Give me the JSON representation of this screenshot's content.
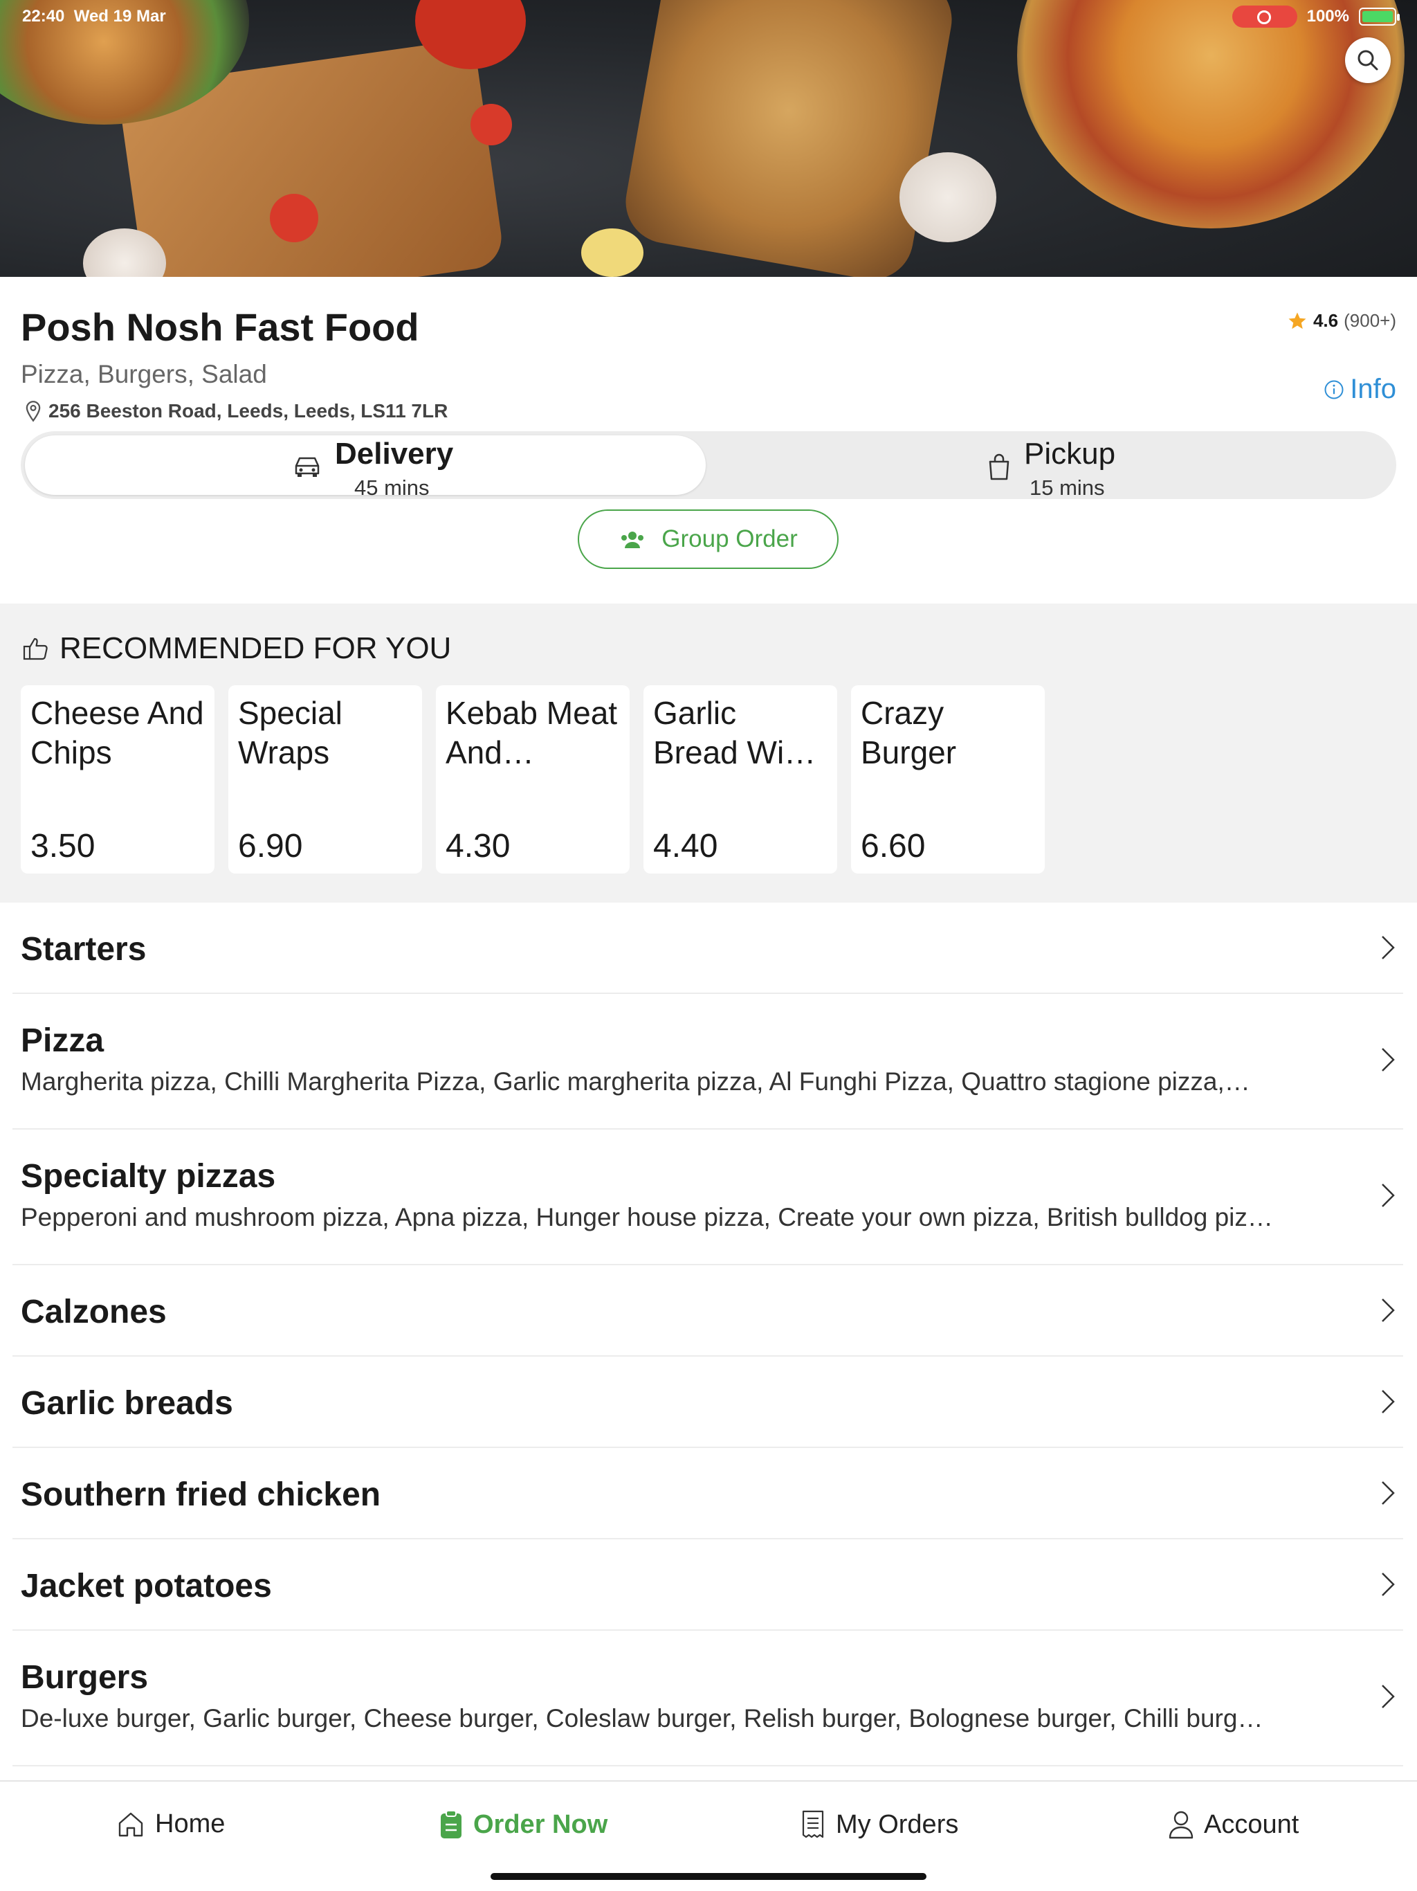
{
  "status_bar": {
    "time": "22:40",
    "date": "Wed 19 Mar",
    "battery": "100%"
  },
  "restaurant": {
    "name": "Posh Nosh Fast Food",
    "cuisines": "Pizza, Burgers, Salad",
    "address": "256 Beeston Road, Leeds, Leeds, LS11 7LR",
    "rating": "4.6",
    "rating_count": "(900+)",
    "info_label": "Info"
  },
  "modes": {
    "delivery": {
      "label": "Delivery",
      "time": "45 mins",
      "selected": true
    },
    "pickup": {
      "label": "Pickup",
      "time": "15 mins",
      "selected": false
    }
  },
  "group_order_label": "Group Order",
  "recommended": {
    "title": "RECOMMENDED FOR YOU",
    "items": [
      {
        "name": "Cheese And Chips",
        "price": "3.50"
      },
      {
        "name": "Special Wraps",
        "price": "6.90"
      },
      {
        "name": "Kebab Meat And…",
        "price": "4.30"
      },
      {
        "name": "Garlic Bread Wi…",
        "price": "4.40"
      },
      {
        "name": "Crazy Burger",
        "price": "6.60"
      }
    ]
  },
  "categories": [
    {
      "name": "Starters",
      "desc": ""
    },
    {
      "name": "Pizza",
      "desc": "Margherita pizza, Chilli Margherita Pizza, Garlic margherita pizza, Al Funghi Pizza, Quattro stagione pizza,…"
    },
    {
      "name": "Specialty pizzas",
      "desc": "Pepperoni and mushroom pizza, Apna pizza, Hunger house pizza, Create your own pizza, British bulldog piz…"
    },
    {
      "name": "Calzones",
      "desc": ""
    },
    {
      "name": "Garlic breads",
      "desc": ""
    },
    {
      "name": "Southern fried chicken",
      "desc": ""
    },
    {
      "name": "Jacket potatoes",
      "desc": ""
    },
    {
      "name": "Burgers",
      "desc": "De-luxe burger, Garlic burger, Cheese burger, Coleslaw burger, Relish burger, Bolognese burger, Chilli burg…"
    }
  ],
  "tabs": {
    "home": "Home",
    "order_now": "Order Now",
    "my_orders": "My Orders",
    "account": "Account"
  },
  "colors": {
    "accent_green": "#4aa54a",
    "link_blue": "#2f8fd6",
    "star": "#f5a623",
    "section_bg": "#f2f2f2"
  }
}
